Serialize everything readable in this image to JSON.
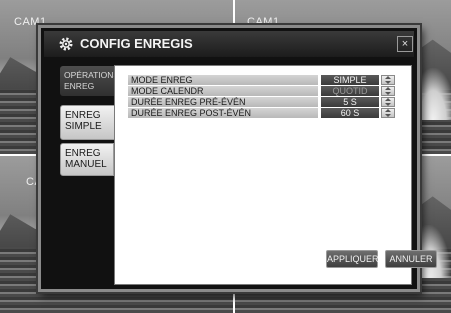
{
  "cameras": [
    {
      "label": "CAM1"
    },
    {
      "label": "CAM1"
    },
    {
      "label": "CA"
    },
    {
      "label": ""
    }
  ],
  "dialog": {
    "title": "CONFIG ENREGIS",
    "close_label": "×",
    "tabs": [
      {
        "label_line1": "OPÉRATIONS",
        "label_line2": "ENREG",
        "active": false
      },
      {
        "label_line1": "ENREG",
        "label_line2": "SIMPLE",
        "active": true
      },
      {
        "label_line1": "ENREG",
        "label_line2": "MANUEL",
        "active": false
      }
    ],
    "settings": [
      {
        "label": "MODE ENREG",
        "value": "SIMPLE",
        "enabled": true
      },
      {
        "label": "MODE CALENDR",
        "value": "QUOTID",
        "enabled": false
      },
      {
        "label": "DURÉE ENREG PRÉ-ÉVÉN",
        "value": "5 S",
        "enabled": true
      },
      {
        "label": "DURÉE ENREG POST-ÉVÉN",
        "value": "60 S",
        "enabled": true
      }
    ],
    "apply_label": "APPLIQUER",
    "cancel_label": "ANNULER"
  }
}
